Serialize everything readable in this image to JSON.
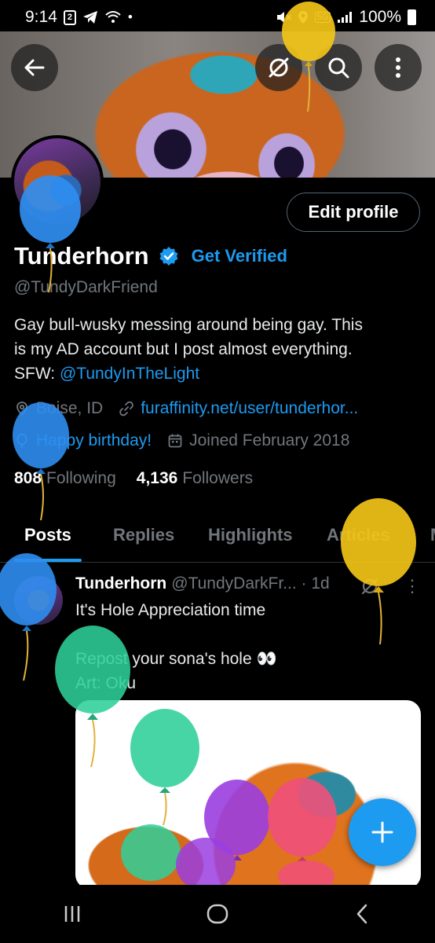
{
  "status_bar": {
    "time": "9:14",
    "notif_badge": "2",
    "battery": "100%",
    "network": "5G"
  },
  "header": {
    "back_icon": "back-arrow-icon",
    "grok_icon": "grok-icon",
    "search_icon": "search-icon",
    "more_icon": "more-vertical-icon"
  },
  "profile": {
    "edit_label": "Edit profile",
    "display_name": "Tunderhorn",
    "get_verified": "Get Verified",
    "handle": "@TundyDarkFriend",
    "bio_line1": "Gay bull-wusky messing around being gay. This",
    "bio_line2": "is my AD account but I post almost everything.",
    "bio_line3_prefix": "SFW: ",
    "bio_line3_link": "@TundyInTheLight",
    "location": "Boise, ID",
    "website": "furaffinity.net/user/tunderhor...",
    "birthday": "Happy birthday!",
    "joined": "Joined February 2018",
    "following_count": "808",
    "following_label": "Following",
    "followers_count": "4,136",
    "followers_label": "Followers"
  },
  "tabs": [
    {
      "label": "Posts",
      "active": true
    },
    {
      "label": "Replies"
    },
    {
      "label": "Highlights"
    },
    {
      "label": "Articles"
    },
    {
      "label": "M"
    }
  ],
  "post": {
    "author": "Tunderhorn",
    "handle_time": "@TundyDarkFr... · 1d",
    "line1": "It's Hole Appreciation time",
    "line2": "Repost your sona's hole 👀",
    "line3": "Art: Oku"
  },
  "colors": {
    "accent": "#1d9bf0",
    "muted": "#71767b",
    "background": "#000000"
  }
}
